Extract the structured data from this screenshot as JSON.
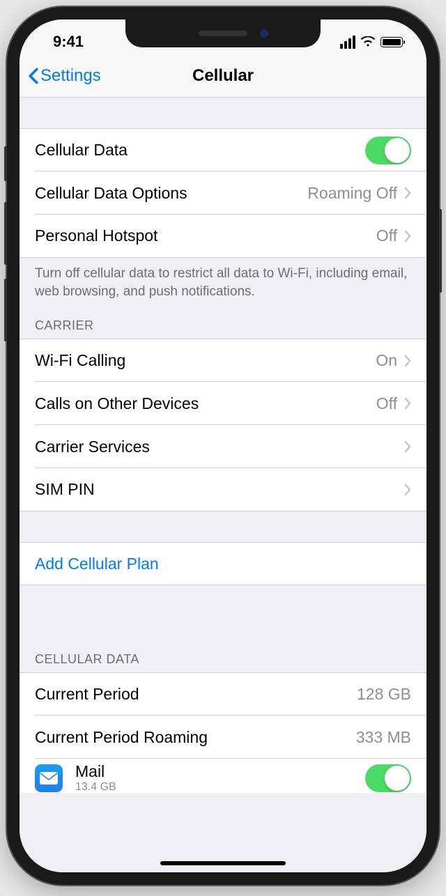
{
  "status": {
    "time": "9:41"
  },
  "nav": {
    "back": "Settings",
    "title": "Cellular"
  },
  "section1": {
    "cellular_data": "Cellular Data",
    "options": "Cellular Data Options",
    "options_detail": "Roaming Off",
    "hotspot": "Personal Hotspot",
    "hotspot_detail": "Off",
    "footer": "Turn off cellular data to restrict all data to Wi-Fi, including email, web browsing, and push notifications."
  },
  "carrier": {
    "header": "CARRIER",
    "wifi_calling": "Wi-Fi Calling",
    "wifi_calling_detail": "On",
    "other_devices": "Calls on Other Devices",
    "other_devices_detail": "Off",
    "services": "Carrier Services",
    "sim_pin": "SIM PIN"
  },
  "add_plan": "Add Cellular Plan",
  "cellular_usage": {
    "header": "CELLULAR DATA",
    "current_period": "Current Period",
    "current_period_val": "128 GB",
    "roaming": "Current Period Roaming",
    "roaming_val": "333 MB"
  },
  "app": {
    "name": "Mail",
    "sub": "13.4 GB"
  }
}
